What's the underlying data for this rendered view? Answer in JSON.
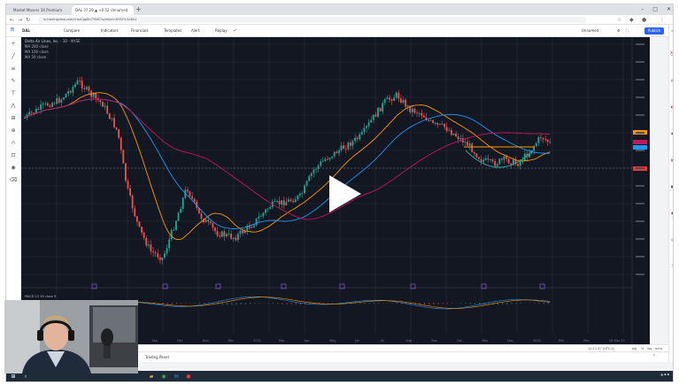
{
  "browser": {
    "tabs": [
      {
        "label": "Market Movers 3X Premium"
      },
      {
        "label": "DAL 37.29 ▲ +0.52 Unnamed"
      }
    ],
    "new_tab": "+",
    "address": "in.tradingview.com/chart/gpBn7YNE/?symbol=NYSE%3ADAL"
  },
  "toolbar": {
    "symbol": "DAL",
    "compare": "Compare",
    "indicators": "Indicators",
    "financials": "Financials",
    "templates": "Templates",
    "alert": "Alert",
    "replay": "Replay",
    "layout": "Unnamed",
    "publish": "Publish"
  },
  "legend": {
    "title": "Delta Air Lines, Inc.",
    "timeframe": "1D",
    "exchange": "NYSE",
    "lines": [
      "MA 200 close",
      "MA 100 close",
      "MA 50 close"
    ]
  },
  "macd": {
    "label": "MACD 12 26 close 9"
  },
  "bottombar": {
    "time": "11:11:47 (UTC-5)",
    "adj": "adj",
    "pct": "%",
    "log": "log",
    "auto": "auto"
  },
  "panel": {
    "label": "Trading Panel"
  },
  "chart_data": {
    "type": "candlestick",
    "time_labels": [
      "Jan",
      "Mar",
      "Jun",
      "Jul",
      "Aug",
      "Sep",
      "Oct",
      "Nov",
      "Dec",
      "2021",
      "Mar",
      "Apr",
      "May",
      "Jun",
      "Jul",
      "Aug",
      "Sep",
      "Oct",
      "Nov",
      "Dec",
      "2022",
      "Feb",
      "Mar",
      "28 Mar 22"
    ],
    "colors": {
      "up": "#26a69a",
      "down": "#ef5350",
      "ma200": "#c2185b",
      "ma100": "#2196f3",
      "ma50": "#ff9800",
      "background": "#131722"
    }
  },
  "colors": {
    "accent": "#2962ff",
    "taskbar": "#1f2b38"
  }
}
